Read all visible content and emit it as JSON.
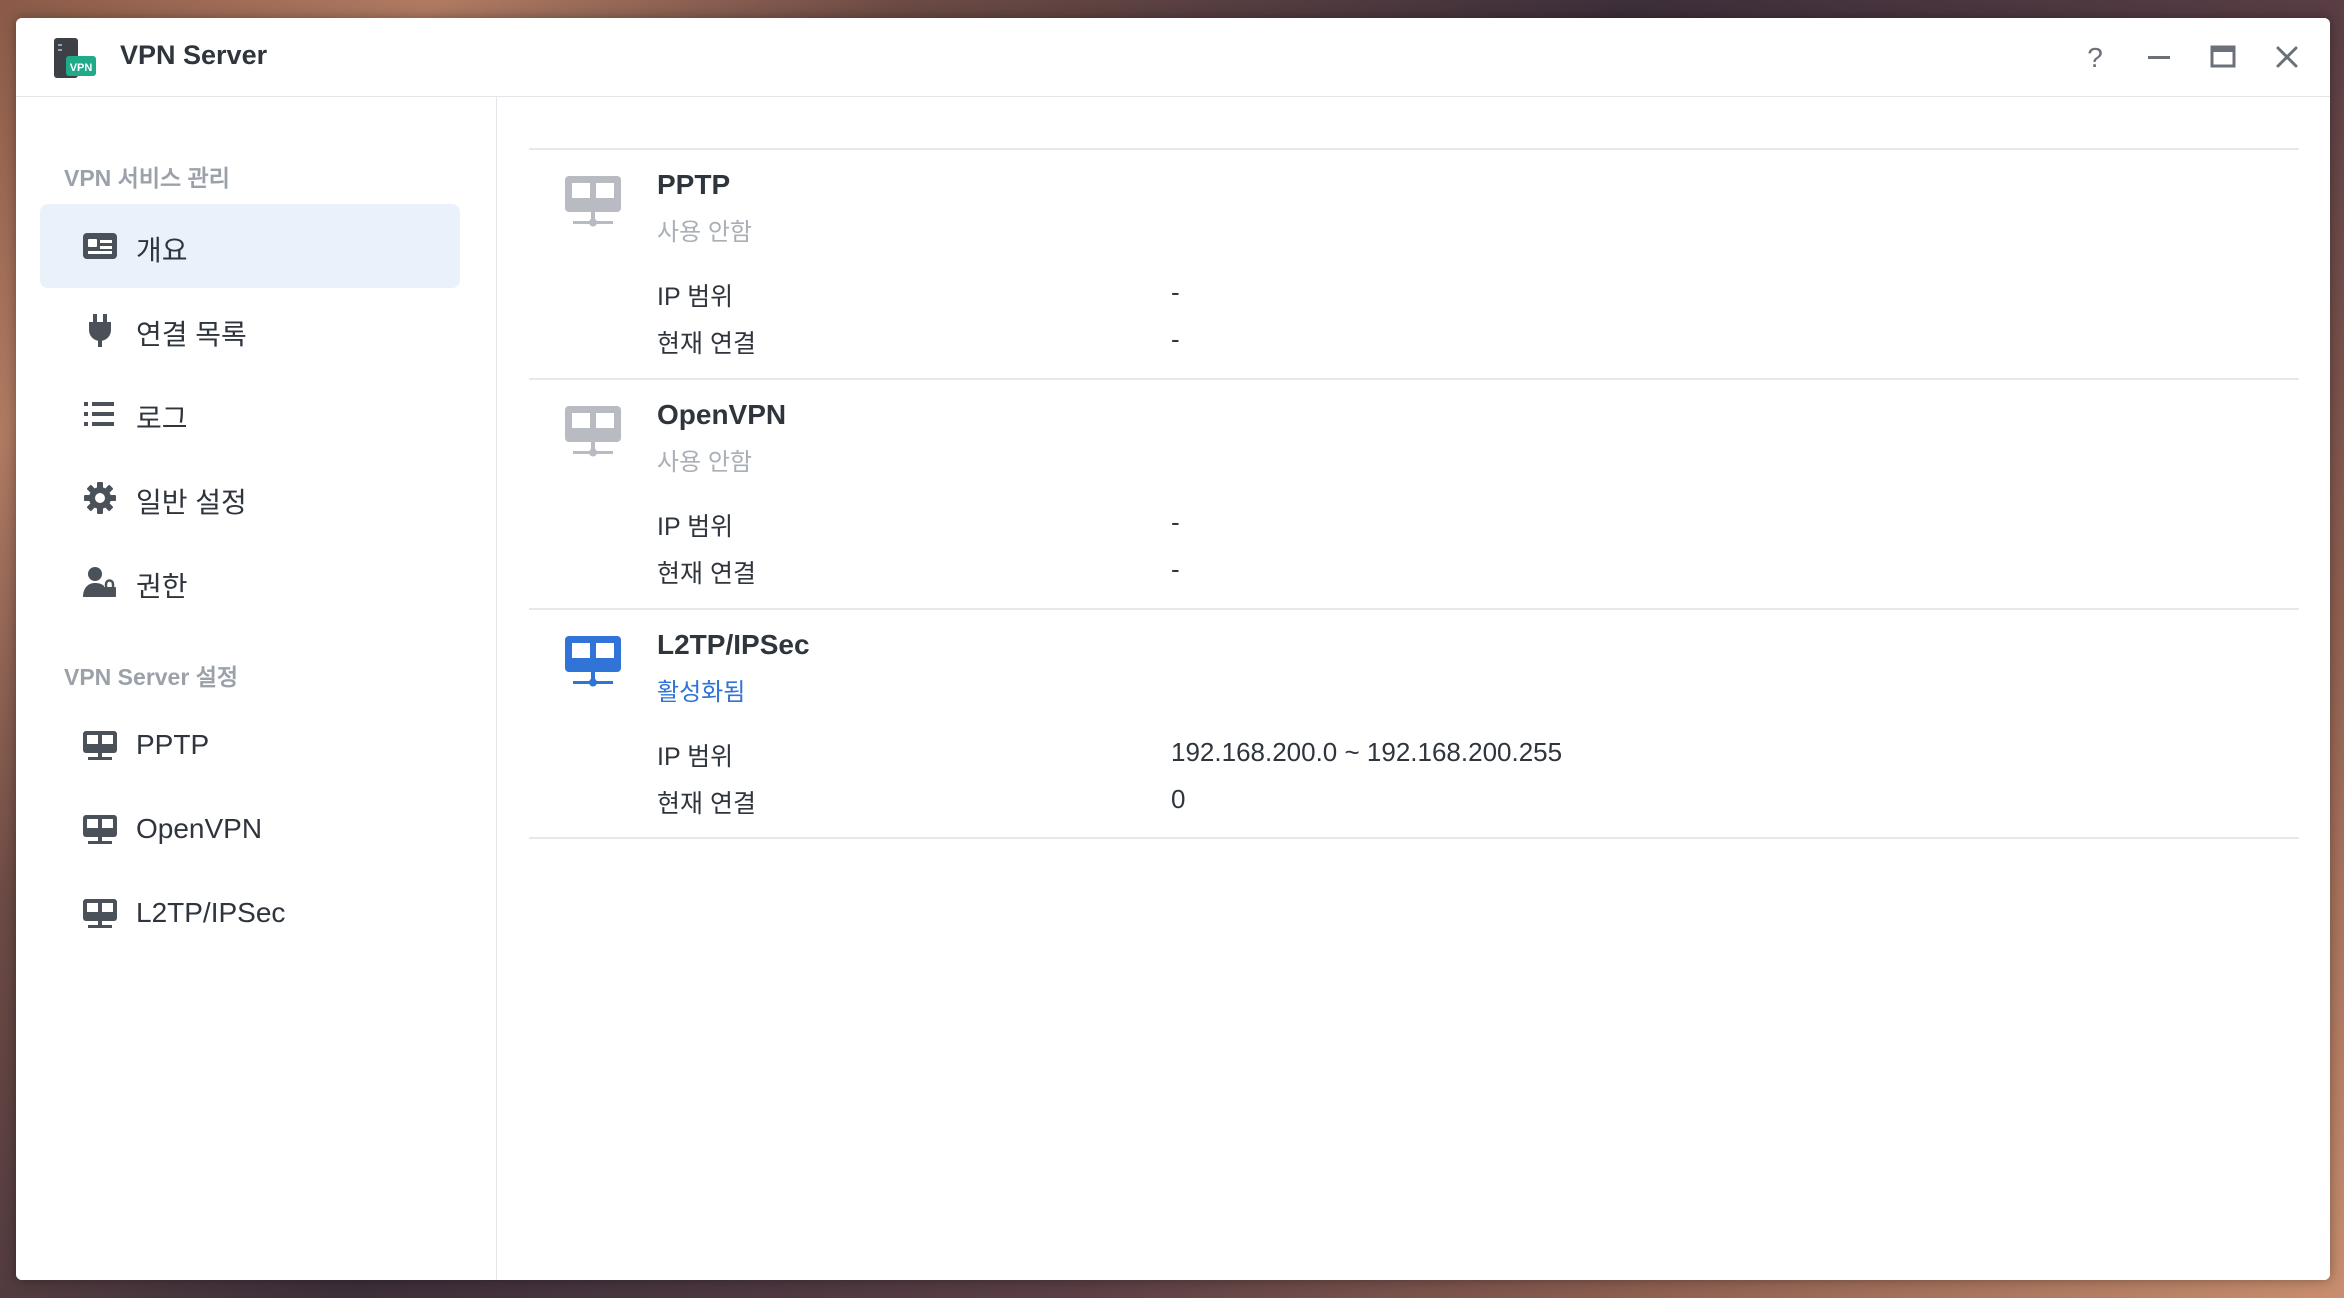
{
  "window": {
    "title": "VPN Server",
    "app_icon_badge": "VPN"
  },
  "sidebar": {
    "section1_title": "VPN 서비스 관리",
    "section1_items": [
      {
        "label": "개요",
        "icon": "overview-card-icon",
        "active": true
      },
      {
        "label": "연결 목록",
        "icon": "plug-icon"
      },
      {
        "label": "로그",
        "icon": "list-icon"
      },
      {
        "label": "일반 설정",
        "icon": "gear-icon"
      },
      {
        "label": "권한",
        "icon": "user-lock-icon"
      }
    ],
    "section2_title": "VPN Server 설정",
    "section2_items": [
      {
        "label": "PPTP",
        "icon": "vpn-server-icon"
      },
      {
        "label": "OpenVPN",
        "icon": "vpn-server-icon"
      },
      {
        "label": "L2TP/IPSec",
        "icon": "vpn-server-icon"
      }
    ]
  },
  "services": [
    {
      "name": "PPTP",
      "status": "사용 안함",
      "enabled": false,
      "ip_range_label": "IP 범위",
      "ip_range": "-",
      "connections_label": "현재 연결",
      "connections": "-"
    },
    {
      "name": "OpenVPN",
      "status": "사용 안함",
      "enabled": false,
      "ip_range_label": "IP 범위",
      "ip_range": "-",
      "connections_label": "현재 연결",
      "connections": "-"
    },
    {
      "name": "L2TP/IPSec",
      "status": "활성화됨",
      "enabled": true,
      "ip_range_label": "IP 범위",
      "ip_range": "192.168.200.0 ~ 192.168.200.255",
      "connections_label": "현재 연결",
      "connections": "0"
    }
  ],
  "colors": {
    "accent": "#2f74d6",
    "active_bg": "#eaf1fb",
    "disabled_icon": "#b8bcc2",
    "text": "#2f353d"
  }
}
